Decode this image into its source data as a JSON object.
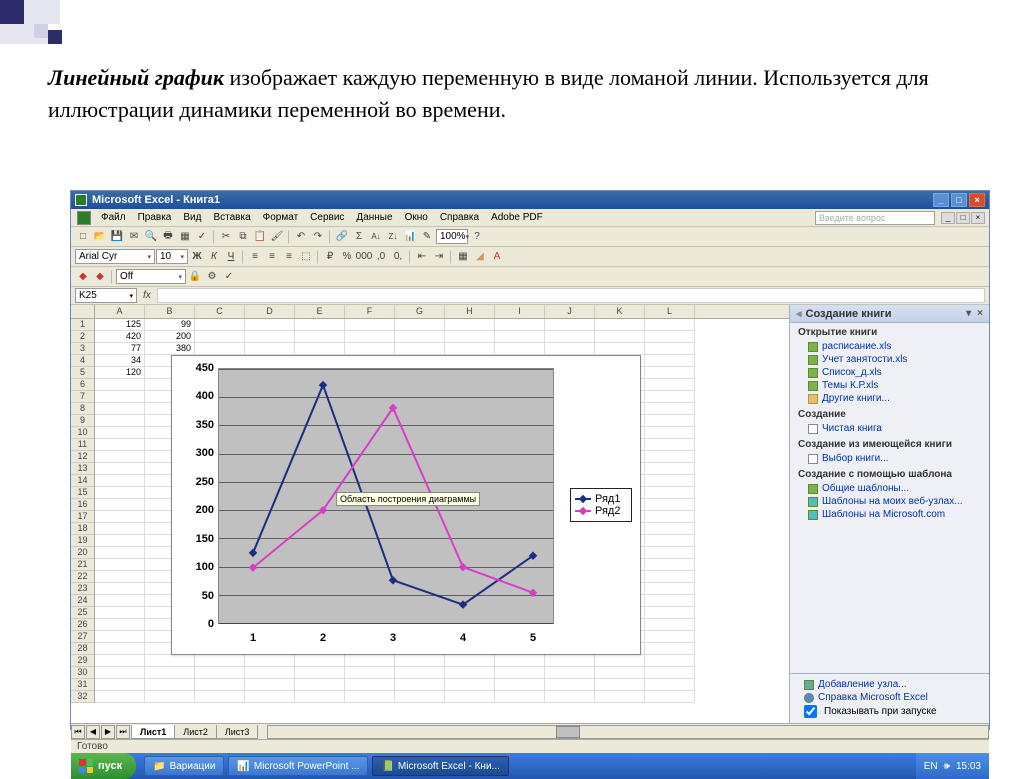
{
  "description": {
    "bold": "Линейный график",
    "rest": " изображает каждую переменную в виде ломаной линии. Используется для иллюстрации динамики переменной во времени."
  },
  "titlebar": {
    "text": "Microsoft Excel - Книга1"
  },
  "menu": {
    "items": [
      "Файл",
      "Правка",
      "Вид",
      "Вставка",
      "Формат",
      "Сервис",
      "Данные",
      "Окно",
      "Справка",
      "Adobe PDF"
    ],
    "question_placeholder": "Введите вопрос"
  },
  "format_toolbar": {
    "font": "Arial Cyr",
    "size": "10"
  },
  "security_box": {
    "label": "Off"
  },
  "zoom": "100%",
  "namebox": "K25",
  "columns": [
    "A",
    "B",
    "C",
    "D",
    "E",
    "F",
    "G",
    "H",
    "I",
    "J",
    "K",
    "L"
  ],
  "cells": {
    "A1": "125",
    "B1": "99",
    "A2": "420",
    "B2": "200",
    "A3": "77",
    "B3": "380",
    "A4": "34",
    "A5": "120"
  },
  "row_count": 32,
  "chart_tooltip": "Область построения диаграммы",
  "legend": {
    "s1": "Ряд1",
    "s2": "Ряд2"
  },
  "sheets": {
    "s1": "Лист1",
    "s2": "Лист2",
    "s3": "Лист3"
  },
  "status": "Готово",
  "taskpane": {
    "title": "Создание книги",
    "open_section": "Открытие книги",
    "open_links": [
      "расписание.xls",
      "Учет занятости.xls",
      "Список_д.xls",
      "Темы К.Р.xls"
    ],
    "open_more": "Другие книги...",
    "create_section": "Создание",
    "create_blank": "Чистая книга",
    "from_existing_section": "Создание из имеющейся книги",
    "from_existing": "Выбор книги...",
    "template_section": "Создание с помощью шаблона",
    "template_links": [
      "Общие шаблоны...",
      "Шаблоны на моих веб-узлах...",
      "Шаблоны на Microsoft.com"
    ],
    "footer_add": "Добавление узла...",
    "footer_help": "Справка Microsoft Excel",
    "footer_show": "Показывать при запуске"
  },
  "taskbar": {
    "start": "пуск",
    "items": [
      "Вариации",
      "Microsoft PowerPoint ...",
      "Microsoft Excel - Кни..."
    ],
    "lang": "EN",
    "time": "15:03"
  },
  "chart_data": {
    "type": "line",
    "x": [
      1,
      2,
      3,
      4,
      5
    ],
    "series": [
      {
        "name": "Ряд1",
        "color": "#1a2f80",
        "values": [
          125,
          420,
          77,
          34,
          120
        ]
      },
      {
        "name": "Ряд2",
        "color": "#d63ec9",
        "values": [
          99,
          200,
          380,
          100,
          55
        ]
      }
    ],
    "ylim": [
      0,
      450
    ],
    "ystep": 50,
    "title": "",
    "xlabel": "",
    "ylabel": "",
    "grid": true,
    "legend_position": "right"
  }
}
